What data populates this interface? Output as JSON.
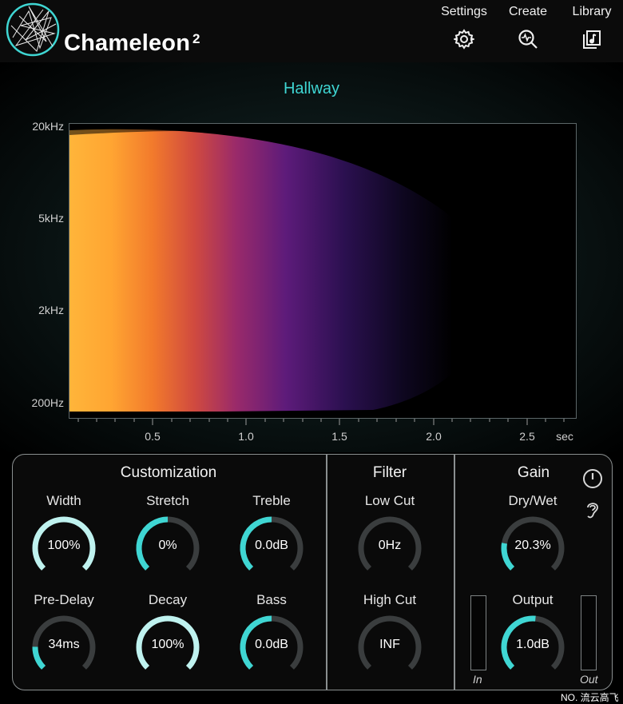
{
  "app": {
    "name": "Chameleon",
    "version": "2"
  },
  "nav": [
    {
      "label": "Settings",
      "icon": "gear-icon"
    },
    {
      "label": "Create",
      "icon": "analyze-icon"
    },
    {
      "label": "Library",
      "icon": "library-icon"
    }
  ],
  "display": {
    "preset": "Hallway",
    "freq_labels": [
      "20kHz",
      "5kHz",
      "2kHz",
      "200Hz"
    ],
    "time_labels": [
      "0.5",
      "1.0",
      "1.5",
      "2.0",
      "2.5"
    ],
    "time_unit": "sec"
  },
  "sections": {
    "customization": "Customization",
    "filter": "Filter",
    "gain": "Gain"
  },
  "knobs": {
    "width": {
      "label": "Width",
      "value": "100%",
      "level": 1.0
    },
    "stretch": {
      "label": "Stretch",
      "value": "0%",
      "level": 0.5
    },
    "treble": {
      "label": "Treble",
      "value": "0.0dB",
      "level": 0.5
    },
    "predelay": {
      "label": "Pre-Delay",
      "value": "34ms",
      "level": 0.17
    },
    "decay": {
      "label": "Decay",
      "value": "100%",
      "level": 1.0
    },
    "bass": {
      "label": "Bass",
      "value": "0.0dB",
      "level": 0.5
    },
    "lowcut": {
      "label": "Low Cut",
      "value": "0Hz",
      "level": 0.0
    },
    "highcut": {
      "label": "High Cut",
      "value": "INF",
      "level": 0.0
    },
    "drywet": {
      "label": "Dry/Wet",
      "value": "20.3%",
      "level": 0.203
    },
    "output": {
      "label": "Output",
      "value": "1.0dB",
      "level": 0.52
    }
  },
  "meters": {
    "in_label": "In",
    "out_label": "Out"
  },
  "side_icons": [
    "power-icon",
    "ear-icon"
  ],
  "watermark": "NO. 流云高飞",
  "colors": {
    "accent": "#3fd6d3",
    "knob_track": "#3a3d3e",
    "knob_full": "#bff2ef"
  }
}
